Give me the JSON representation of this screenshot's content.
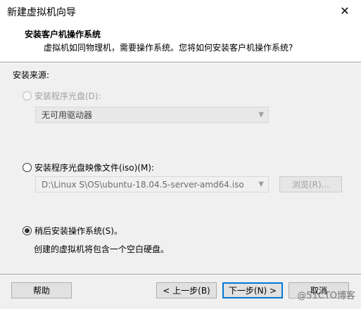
{
  "window": {
    "title": "新建虚拟机向导",
    "close_glyph": "✕"
  },
  "header": {
    "title": "安装客户机操作系统",
    "subtitle": "虚拟机如同物理机，需要操作系统。您将如何安装客户机操作系统?"
  },
  "source": {
    "label": "安装来源:",
    "options": [
      {
        "label": "安装程序光盘(D):",
        "checked": false,
        "enabled": false
      },
      {
        "label": "安装程序光盘映像文件(iso)(M):",
        "checked": false,
        "enabled": true
      },
      {
        "label": "稍后安装操作系统(S)。",
        "checked": true,
        "enabled": true
      }
    ],
    "disc_dropdown_value": "无可用驱动器",
    "iso_path_value": "D:\\Linux S\\OS\\ubuntu-18.04.5-server-amd64.iso",
    "browse_label": "浏览(R)...",
    "later_description": "创建的虚拟机将包含一个空白硬盘。"
  },
  "footer": {
    "help_label": "帮助",
    "back_label": "< 上一步(B)",
    "next_label": "下一步(N) >",
    "cancel_label": "取消"
  },
  "watermark": "@51CTO博客",
  "icons": {
    "dropdown_arrow": "chevron-down-icon",
    "close": "close-icon"
  }
}
